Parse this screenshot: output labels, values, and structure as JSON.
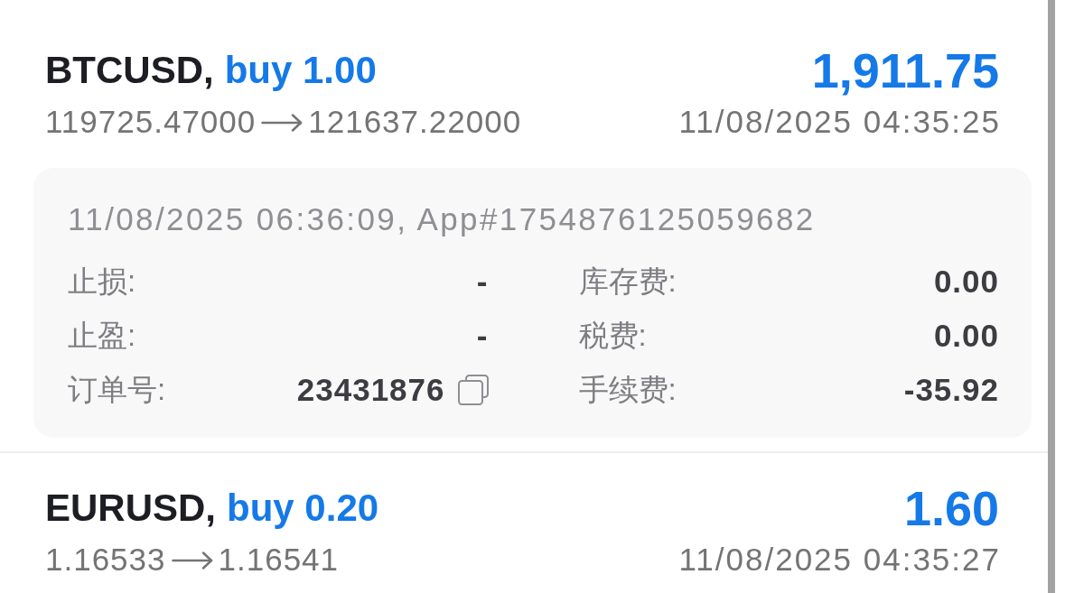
{
  "trades": [
    {
      "symbol": "BTCUSD,",
      "order": "buy 1.00",
      "profit": "1,911.75",
      "open_price": "119725.47000",
      "close_price": "121637.22000",
      "time": "11/08/2025 04:35:25",
      "details": {
        "header": "11/08/2025 06:36:09, App#1754876125059682",
        "fields": [
          {
            "kind": "text",
            "label": "止损:",
            "value": "-"
          },
          {
            "kind": "text",
            "label": "库存费:",
            "value": "0.00"
          },
          {
            "kind": "text",
            "label": "止盈:",
            "value": "-"
          },
          {
            "kind": "text",
            "label": "税费:",
            "value": "0.00"
          },
          {
            "kind": "copy",
            "label": "订单号:",
            "value": "23431876"
          },
          {
            "kind": "text",
            "label": "手续费:",
            "value": "-35.92"
          }
        ]
      }
    },
    {
      "symbol": "EURUSD,",
      "order": "buy 0.20",
      "profit": "1.60",
      "open_price": "1.16533",
      "close_price": "1.16541",
      "time": "11/08/2025 04:35:27"
    }
  ]
}
